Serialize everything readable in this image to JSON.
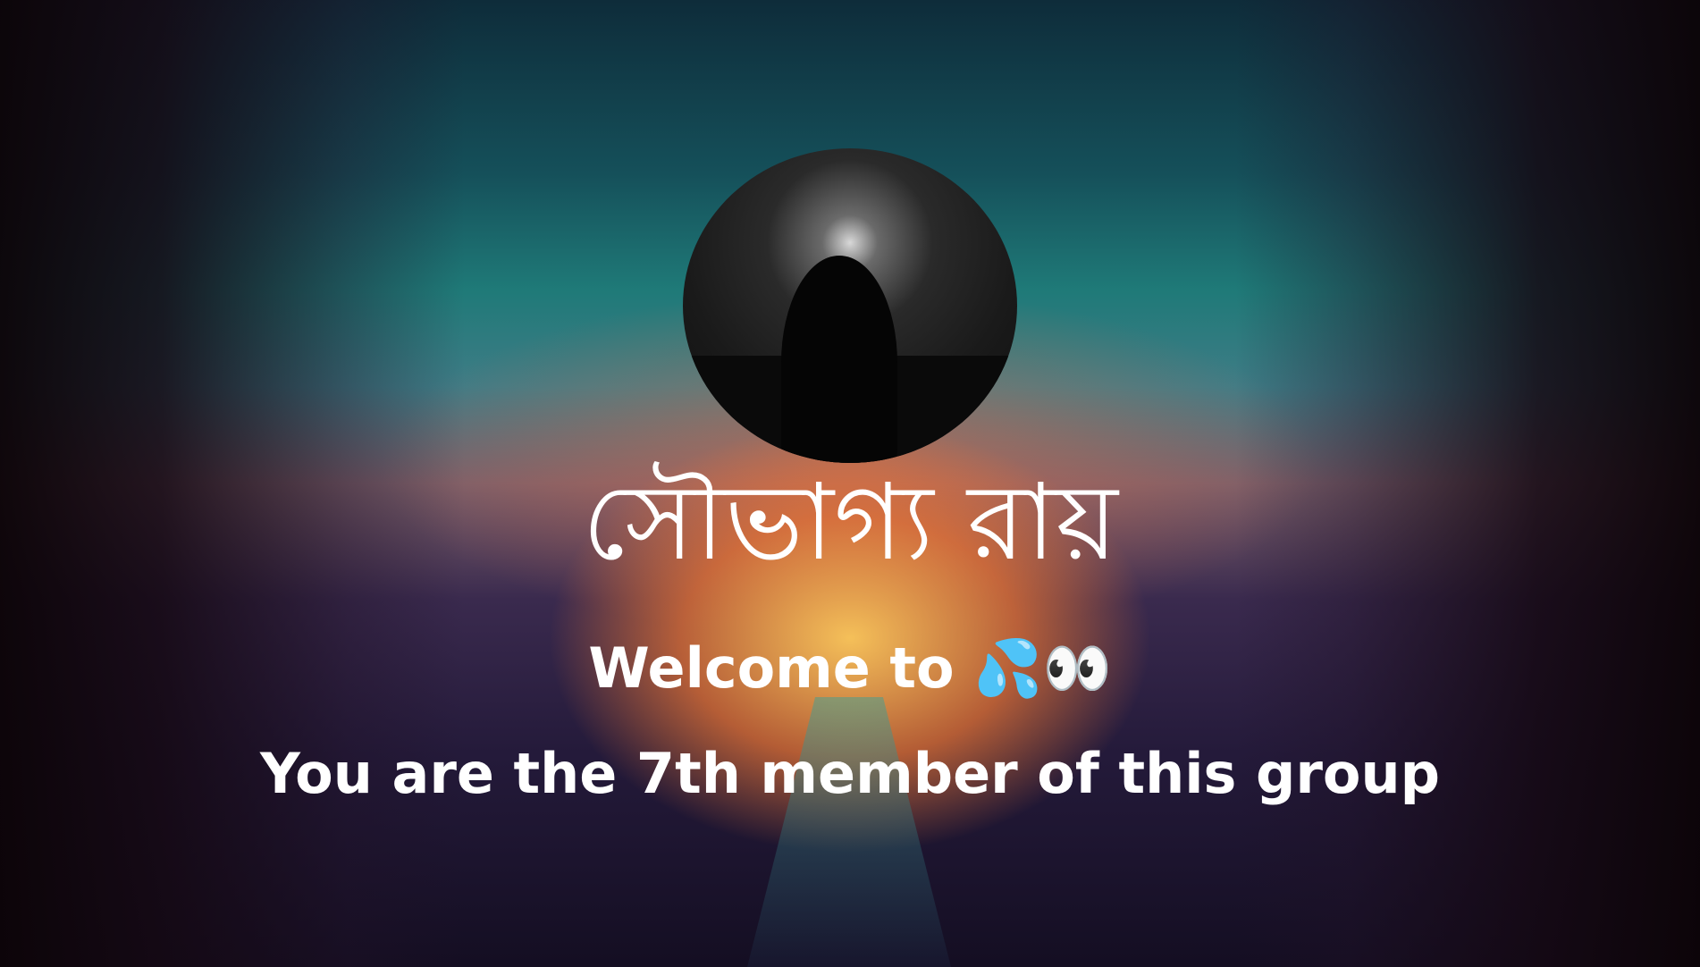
{
  "card": {
    "name": "সৌভাগ্য রায়",
    "welcome": "Welcome to 💦👀",
    "member_text": "You are the 7th member of this group"
  }
}
